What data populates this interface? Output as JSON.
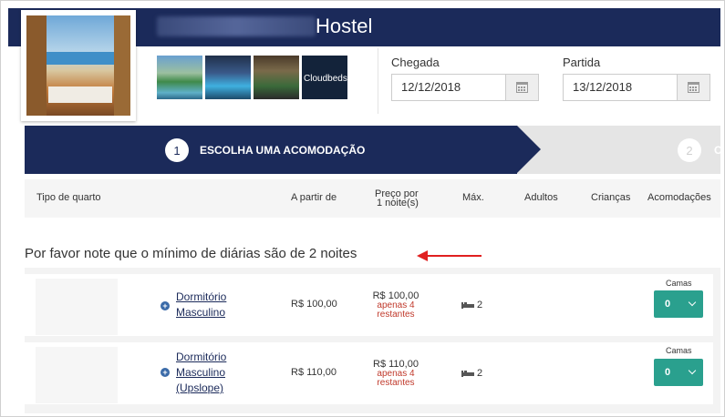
{
  "header": {
    "title": "Hostel",
    "brand_thumb_text": "Cloudbeds"
  },
  "dates": {
    "checkin_label": "Chegada",
    "checkin_value": "12/12/2018",
    "checkout_label": "Partida",
    "checkout_value": "13/12/2018"
  },
  "steps": [
    {
      "num": "1",
      "label": "ESCOLHA UMA ACOMODAÇÃO"
    },
    {
      "num": "2",
      "label": "C"
    }
  ],
  "table_headers": {
    "room_type": "Tipo de quarto",
    "from": "A partir de",
    "price_line1": "Preço por",
    "price_line2": "1 noite(s)",
    "max": "Máx.",
    "adults": "Adultos",
    "children": "Crianças",
    "accommodations": "Acomodações"
  },
  "notice": "Por favor note que o mínimo de diárias são de 2 noites",
  "rooms": [
    {
      "name_lines": [
        "Dormitório",
        "Masculino"
      ],
      "from_price": "R$ 100,00",
      "price": "R$ 100,00",
      "remaining_1": "apenas 4",
      "remaining_2": "restantes",
      "max": "2",
      "beds_label": "Camas",
      "beds_value": "0"
    },
    {
      "name_lines": [
        "Dormitório",
        "Masculino",
        "(Upslope)"
      ],
      "from_price": "R$ 110,00",
      "price": "R$ 110,00",
      "remaining_1": "apenas 4",
      "remaining_2": "restantes",
      "max": "2",
      "beds_label": "Camas",
      "beds_value": "0"
    }
  ],
  "colors": {
    "navy": "#1b2a5a",
    "teal": "#2aa08e",
    "alert_red": "#c0392b",
    "arrow_red": "#e02020"
  }
}
